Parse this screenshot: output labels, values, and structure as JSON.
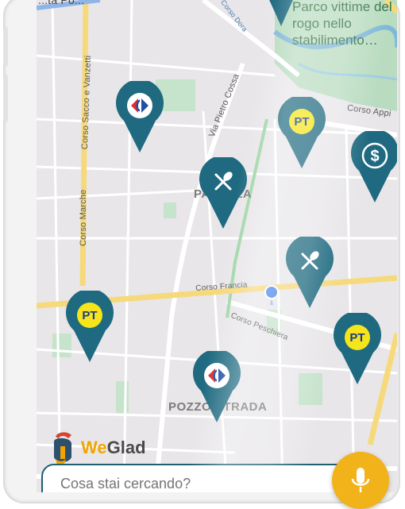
{
  "map": {
    "park_label": "Parco vittime del rogo nello stabilimento…",
    "top_label": "...ta Po...",
    "streets": {
      "corso_sacco_vanzetti": "Corso Sacco e Vanzetti",
      "corso_marche": "Corso Marche",
      "via_pietro_cossa": "Via Pietro Cossa",
      "corso_appio": "Corso Appi",
      "corso_francia": "Corso Francia",
      "corso_peschiera": "Corso Peschiera",
      "corso_dora": "Corso Dora"
    },
    "districts": {
      "parella": "PARELLA",
      "pozzo_strada": "POZZO STRADA"
    }
  },
  "pins": [
    {
      "type": "supermarket",
      "icon": "carrefour-icon"
    },
    {
      "type": "post-office",
      "icon": "pt-icon",
      "label": "PT"
    },
    {
      "type": "bank",
      "icon": "dollar-icon",
      "label": "$"
    },
    {
      "type": "restaurant",
      "icon": "fork-knife-icon"
    },
    {
      "type": "restaurant",
      "icon": "fork-knife-icon"
    },
    {
      "type": "post-office",
      "icon": "pt-icon",
      "label": "PT"
    },
    {
      "type": "post-office",
      "icon": "pt-icon",
      "label": "PT"
    },
    {
      "type": "supermarket",
      "icon": "carrefour-icon"
    }
  ],
  "brand": {
    "name_part1": "We",
    "name_part2": "Glad"
  },
  "search": {
    "placeholder": "Cosa stai cercando?"
  },
  "colors": {
    "pin": "#1f6a80",
    "brand_accent": "#f0a500",
    "mic": "#f2b21a",
    "road_major": "#f6d97a",
    "park": "#b9dcc0",
    "water": "#7fb8d8"
  }
}
